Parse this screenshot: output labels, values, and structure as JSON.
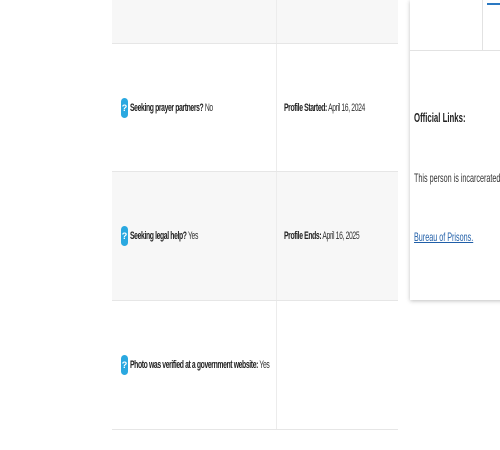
{
  "rows": [
    {
      "left": {
        "label": "Seeking prayer partners?",
        "value": " No"
      },
      "right": {
        "label": "Profile Started:",
        "value": " April 16, 2024"
      }
    },
    {
      "left": {
        "label": "Seeking legal help?",
        "value": " Yes"
      },
      "right": {
        "label": "Profile Ends:",
        "value": " April 16, 2025"
      }
    },
    {
      "left": {
        "label": "Photo was verified at a government website:",
        "value": " Yes"
      }
    }
  ],
  "help_icon_glyph": "?",
  "accent_color": "#2aa8e0",
  "link_color": "#1f5ea8",
  "official_links": {
    "heading": "Official Links:",
    "text": "This person is incarcerated in the",
    "link_label": "Bureau of Prisons."
  }
}
